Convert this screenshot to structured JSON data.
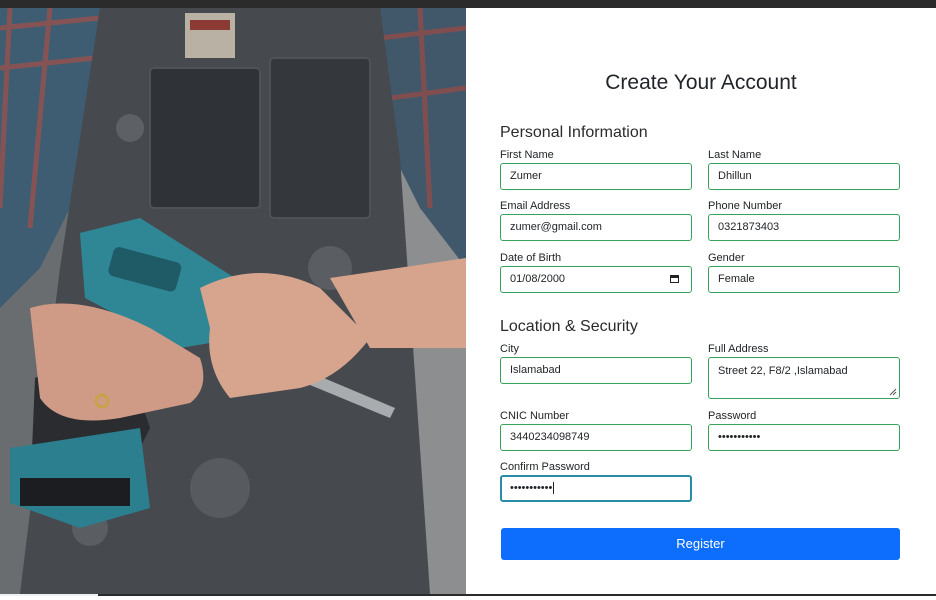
{
  "form": {
    "title": "Create Your Account",
    "personal_section": "Personal Information",
    "location_section": "Location & Security",
    "fields": {
      "first_name": {
        "label": "First Name",
        "value": "Zumer"
      },
      "last_name": {
        "label": "Last Name",
        "value": "Dhillun"
      },
      "email": {
        "label": "Email Address",
        "value": "zumer@gmail.com"
      },
      "phone": {
        "label": "Phone Number",
        "value": "0321873403"
      },
      "dob": {
        "label": "Date of Birth",
        "value": "01/08/2000"
      },
      "gender": {
        "label": "Gender",
        "value": "Female"
      },
      "city": {
        "label": "City",
        "value": "Islamabad"
      },
      "address": {
        "label": "Full Address",
        "value": "Street 22, F8/2 ,Islamabad"
      },
      "cnic": {
        "label": "CNIC Number",
        "value": "3440234098749"
      },
      "password": {
        "label": "Password",
        "value": "•••••••••••"
      },
      "confirm_password": {
        "label": "Confirm Password",
        "value": "•••••••••••"
      }
    },
    "register_label": "Register"
  },
  "colors": {
    "accent": "#0d6efd",
    "field_border": "#37a35a",
    "focus_border": "#2a8aa8"
  },
  "icons": [
    "calendar-icon",
    "resize-handle-icon"
  ]
}
